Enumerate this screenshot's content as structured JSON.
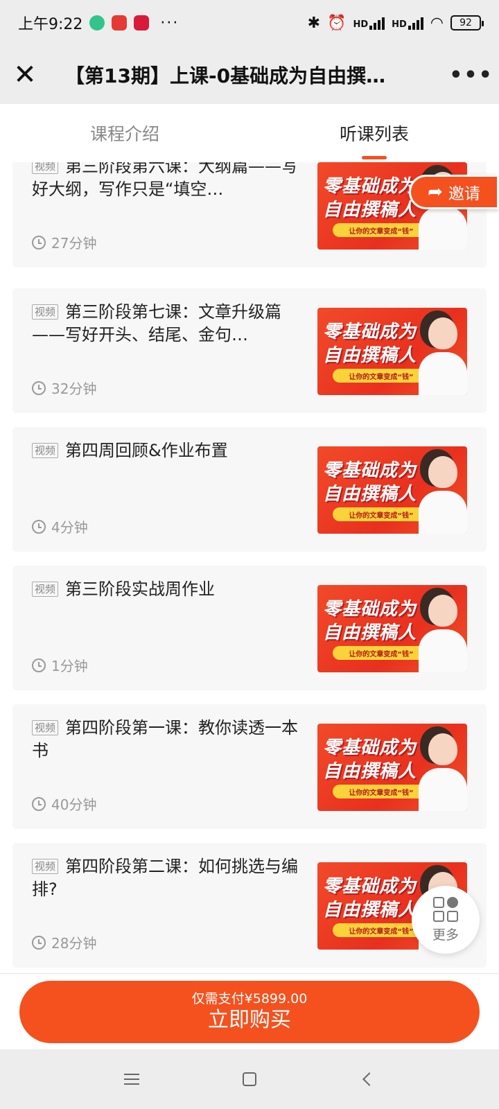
{
  "status_bar": {
    "time": "上午9:22",
    "app_badges": [
      "小红书",
      "有品"
    ],
    "more": "···",
    "signal_label_1": "HD",
    "signal_label_2": "HD",
    "battery": "92"
  },
  "header": {
    "title": "【第13期】上课-0基础成为自由撰…"
  },
  "tabs": [
    {
      "label": "课程介绍",
      "active": false
    },
    {
      "label": "听课列表",
      "active": true
    }
  ],
  "thumbnail": {
    "line1": "零基础成为",
    "line2": "自由撰稿人",
    "band": "让你的文章变成“钱”"
  },
  "lessons": [
    {
      "tag": "视频",
      "title": "第三阶段第六课：大纲篇——写好大纲，写作只是“填空…",
      "duration": "27分钟"
    },
    {
      "tag": "视频",
      "title": "第三阶段第七课：文章升级篇——写好开头、结尾、金句…",
      "duration": "32分钟"
    },
    {
      "tag": "视频",
      "title": "第四周回顾&作业布置",
      "duration": "4分钟"
    },
    {
      "tag": "视频",
      "title": "第三阶段实战周作业",
      "duration": "1分钟"
    },
    {
      "tag": "视频",
      "title": "第四阶段第一课：教你读透一本书",
      "duration": "40分钟"
    },
    {
      "tag": "视频",
      "title": "第四阶段第二课：如何挑选与编排?",
      "duration": "28分钟"
    }
  ],
  "invite": {
    "label": "邀请"
  },
  "more_float": {
    "label": "更多"
  },
  "buy": {
    "price_text": "仅需支付¥5899.00",
    "button_label": "立即购买"
  },
  "colors": {
    "accent": "#f4511e",
    "thumb_red": "#e8301e",
    "band_yellow": "#f9d33a"
  }
}
